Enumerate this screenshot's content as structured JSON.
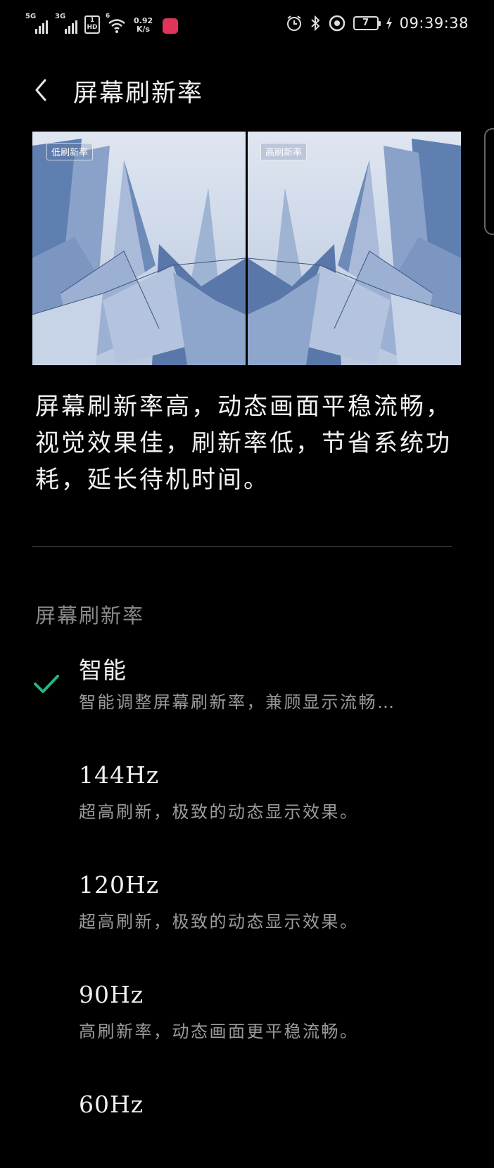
{
  "status_bar": {
    "signal1_label": "5G",
    "signal2_label": "3G",
    "hd_label": "1\nHD",
    "wifi_label": "6",
    "net_speed_value": "0.92",
    "net_speed_unit": "K/s",
    "battery_level": "7",
    "time": "09:39:38",
    "icons": [
      "alarm-icon",
      "bluetooth-icon",
      "data-saver-icon",
      "charging-icon"
    ]
  },
  "header": {
    "title": "屏幕刷新率",
    "back_icon": "chevron-left-icon"
  },
  "preview": {
    "left_label": "低刷新率",
    "right_label": "高刷新率"
  },
  "description": "屏幕刷新率高，动态画面平稳流畅，视觉效果佳，刷新率低，节省系统功耗，延长待机时间。",
  "section_title": "屏幕刷新率",
  "options": [
    {
      "title": "智能",
      "subtitle": "智能调整屏幕刷新率，兼顾显示流畅…",
      "selected": true
    },
    {
      "title": "144Hz",
      "subtitle": "超高刷新，极致的动态显示效果。",
      "selected": false
    },
    {
      "title": "120Hz",
      "subtitle": "超高刷新，极致的动态显示效果。",
      "selected": false
    },
    {
      "title": "90Hz",
      "subtitle": "高刷新率，动态画面更平稳流畅。",
      "selected": false
    },
    {
      "title": "60Hz",
      "subtitle": "",
      "selected": false
    }
  ],
  "colors": {
    "background": "#000000",
    "check": "#27b388",
    "subtitle": "#9a9a9a",
    "section": "#8a8a8a"
  }
}
